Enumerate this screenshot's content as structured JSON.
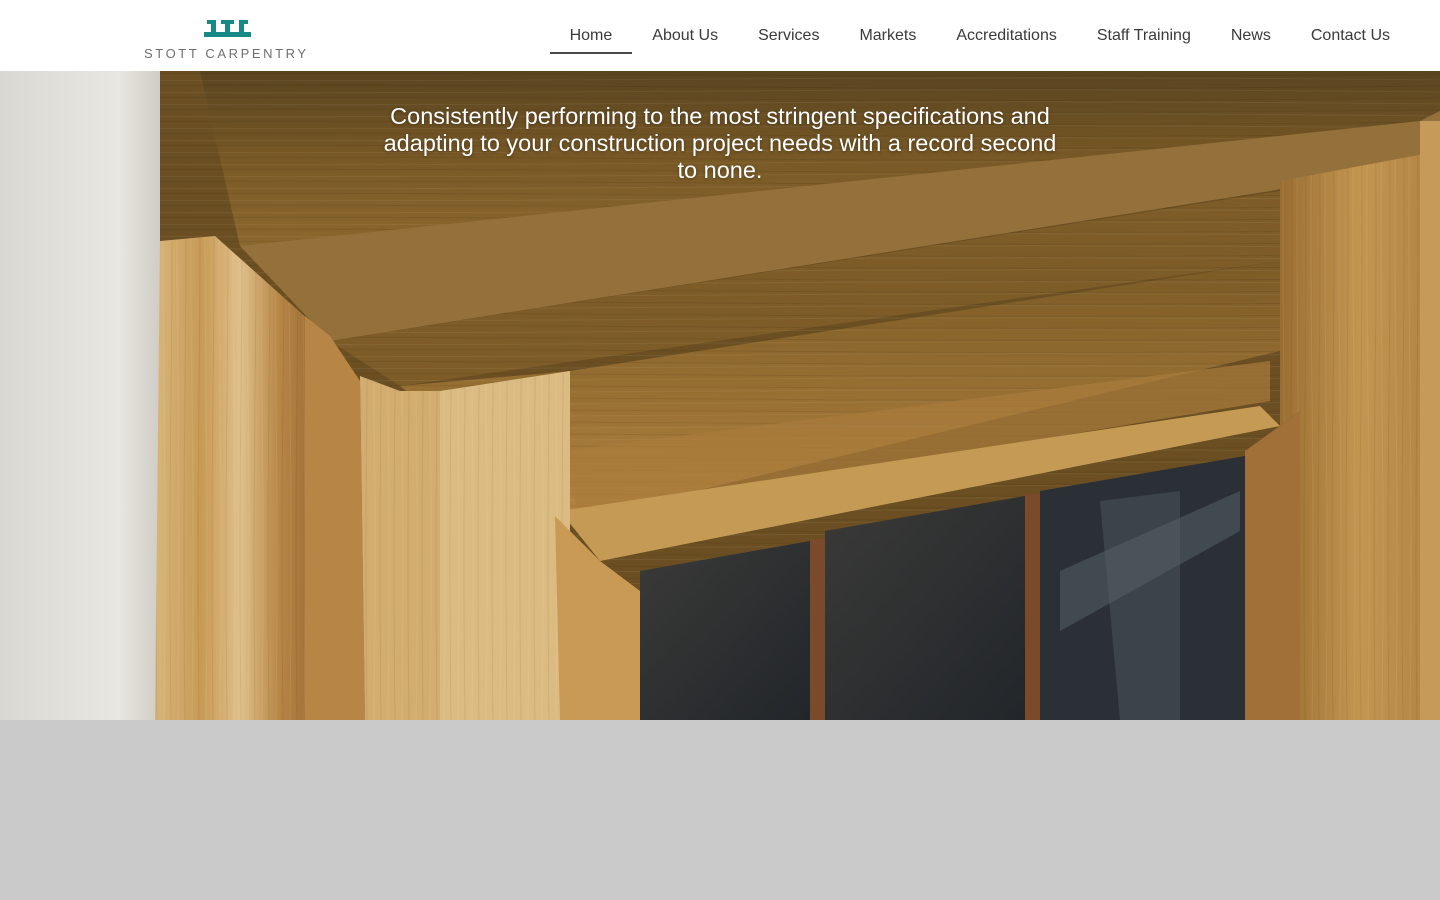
{
  "brand": {
    "name": "STOTT CARPENTRY",
    "accent_color": "#178a87",
    "logo_icon": "stott-carpentry-logo-icon"
  },
  "nav": {
    "items": [
      {
        "label": "Home",
        "active": true
      },
      {
        "label": "About Us",
        "active": false
      },
      {
        "label": "Services",
        "active": false
      },
      {
        "label": "Markets",
        "active": false
      },
      {
        "label": "Accreditations",
        "active": false
      },
      {
        "label": "Staff Training",
        "active": false
      },
      {
        "label": "News",
        "active": false
      },
      {
        "label": "Contact Us",
        "active": false
      }
    ]
  },
  "hero": {
    "tagline": "Consistently performing to the most stringent specifications and adapting to your construction project needs with a record second to none.",
    "image": "oak-window-frame-photo"
  },
  "colors": {
    "header_bg": "#ffffff",
    "page_bg": "#cacaca",
    "nav_text": "#3a3a3a",
    "hero_text": "#ffffff"
  }
}
